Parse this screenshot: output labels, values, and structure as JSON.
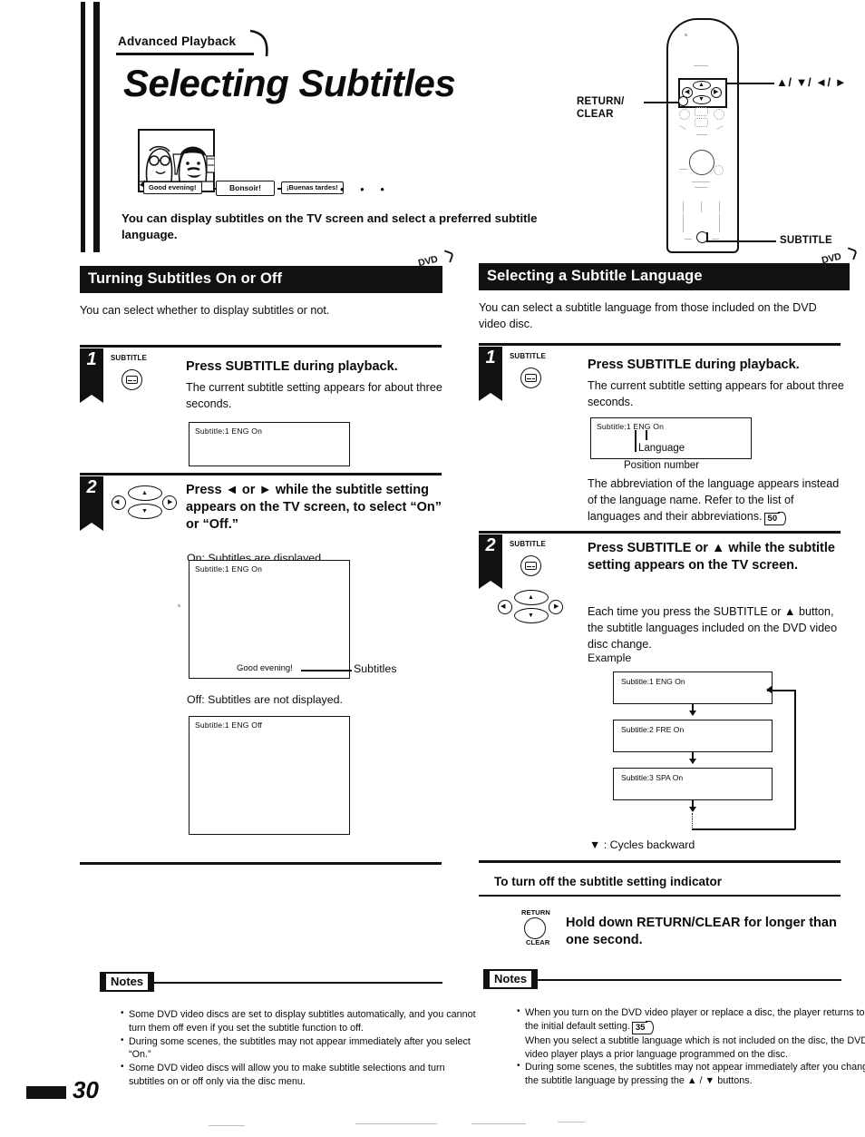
{
  "header": {
    "kicker": "Advanced Playback",
    "title": "Selecting Subtitles",
    "lede": "You can display subtitles on the TV screen and select a preferred subtitle language."
  },
  "cartoon": {
    "bubble_en": "Good evening!",
    "bubble_fr": "Bonsoir!",
    "bubble_es": "¡Buenas tardes!",
    "ellipsis": "• • •"
  },
  "remote": {
    "label_return_clear": "RETURN/\nCLEAR",
    "label_arrows": "▲/ ▼/ ◄/ ►",
    "label_subtitle": "SUBTITLE"
  },
  "left_section": {
    "heading": "Turning Subtitles On or Off",
    "badge": "DVD",
    "intro": "You can select whether to display subtitles or not.",
    "steps": [
      {
        "num": "1",
        "button_label": "SUBTITLE",
        "button_icon": "subtitle-icon",
        "title": "Press SUBTITLE during playback.",
        "body": "The current subtitle setting appears for about three seconds.",
        "screen_osd": "Subtitle:1  ENG   On"
      },
      {
        "num": "2",
        "button_icon": "arrow-cluster-icon",
        "title": "Press ◄ or ► while the subtitle setting appears on the TV screen, to select “On” or “Off.”",
        "on_caption": "On: Subtitles are displayed.",
        "on_screen_osd": "Subtitle:1  ENG   On",
        "on_screen_subtitle_text": "Good evening!",
        "on_screen_callout": "Subtitles",
        "off_caption": "Off: Subtitles are not displayed.",
        "off_screen_osd": "Subtitle:1  ENG   Off"
      }
    ],
    "notes_title": "Notes",
    "notes": [
      "Some DVD video discs are set to display subtitles automatically, and you cannot turn them off even if you set the subtitle function to off.",
      "During some scenes, the subtitles may not appear immediately after you select “On.”",
      "Some DVD video discs will allow you to make subtitle selections and turn subtitles on or off only via the disc menu."
    ]
  },
  "right_section": {
    "heading": "Selecting a Subtitle Language",
    "badge": "DVD",
    "intro": "You can select a subtitle language from those included on the DVD video disc.",
    "steps": [
      {
        "num": "1",
        "button_label": "SUBTITLE",
        "button_icon": "subtitle-icon",
        "title": "Press SUBTITLE during playback.",
        "body": "The current subtitle setting appears for about three seconds.",
        "screen_osd": "Subtitle:1  ENG   On",
        "annot_language": "Language",
        "annot_position": "Position number",
        "body2": "The abbreviation of the language appears instead of the language name. Refer to the list of languages and their abbreviations.",
        "body2_page_ref": "50"
      },
      {
        "num": "2",
        "button_label": "SUBTITLE",
        "button_icon": "subtitle-icon",
        "title": "Press SUBTITLE or ▲ while the subtitle setting appears on the TV screen.",
        "body": "Each time you press the SUBTITLE or ▲ button, the subtitle languages included on the DVD video disc change.",
        "example_label": "Example",
        "example_boxes": [
          "Subtitle:1  ENG   On",
          "Subtitle:2  FRE   On",
          "Subtitle:3  SPA   On"
        ],
        "cycle_note": "▼ : Cycles backward"
      }
    ],
    "subheading": "To turn off the subtitle setting indicator",
    "return_button_top": "RETURN",
    "return_button_bottom": "CLEAR",
    "return_instruction": "Hold down RETURN/CLEAR for longer than one second.",
    "notes_title": "Notes",
    "notes": [
      {
        "text": "When you turn on the DVD video player or replace a disc, the player returns to the initial default setting.",
        "page_ref": "35",
        "sub": "When you select a subtitle language which is not included on the disc, the DVD video player plays a prior language programmed on the disc."
      },
      {
        "text": "During some scenes, the subtitles may not appear immediately after you change the subtitle language by pressing the ▲ / ▼ buttons.",
        "page_ref": "",
        "sub": ""
      }
    ]
  },
  "footer": {
    "page_number": "30"
  }
}
